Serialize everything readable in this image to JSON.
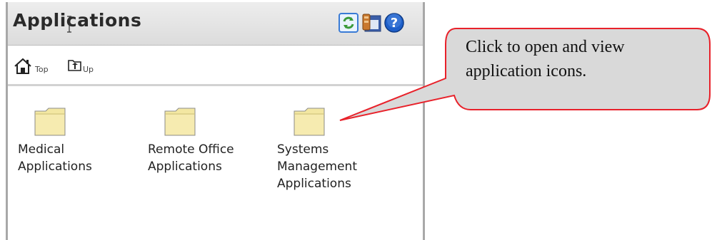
{
  "window": {
    "title": "Applications",
    "toolbar_icons": [
      "refresh-icon",
      "tools-icon",
      "help-icon"
    ]
  },
  "nav": {
    "top_label": "Top",
    "up_label": "Up"
  },
  "folders": [
    {
      "label": "Medical\nApplications",
      "icon": "folder-icon"
    },
    {
      "label": "Remote Office\nApplications",
      "icon": "folder-icon"
    },
    {
      "label": "Systems\nManagement\nApplications",
      "icon": "folder-icon"
    }
  ],
  "callout": {
    "text": "Click to open and view\napplication icons.",
    "border_color": "#e8212a",
    "fill_color": "#d9d9d9"
  },
  "colors": {
    "folder_fill": "#f3e7a2",
    "help_blue": "#1e5fc9",
    "refresh_green": "#3a9a3a"
  }
}
